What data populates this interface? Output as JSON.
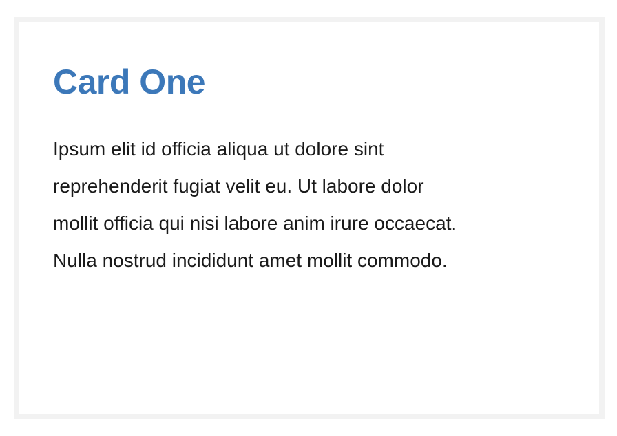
{
  "card": {
    "title": "Card One",
    "title_color": "#3c78b9",
    "body_lines": [
      "Ipsum elit id officia aliqua ut dolore sint",
      "reprehenderit fugiat velit eu. Ut labore dolor",
      "mollit officia qui nisi labore anim irure occaecat.",
      "Nulla nostrud incididunt amet mollit commodo."
    ]
  }
}
